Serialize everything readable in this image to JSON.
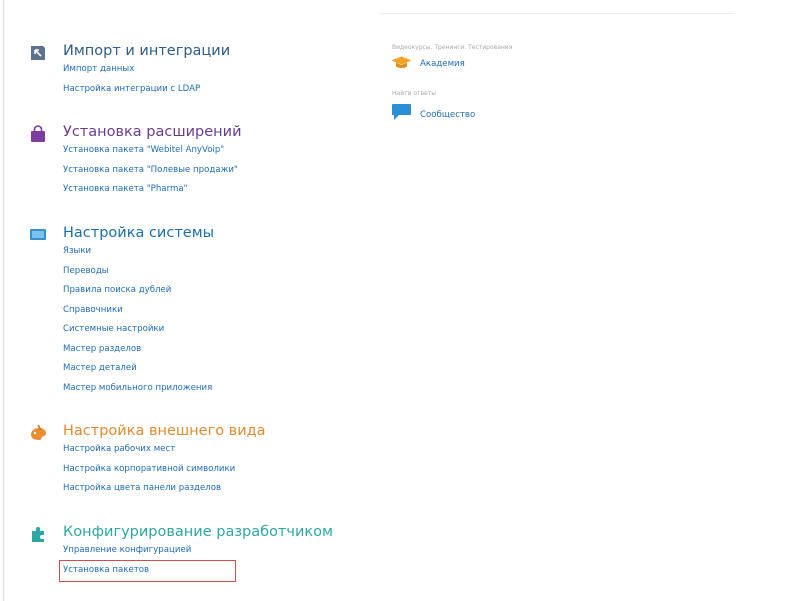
{
  "colors": {
    "link": "#1f6bb4",
    "import_title": "#2d5c86",
    "extensions_title": "#6a3c8e",
    "system_title": "#1d6fa7",
    "appearance_title": "#e08a32",
    "dev_title": "#2ea7a2",
    "highlight_border": "#d94a4a"
  },
  "sections": [
    {
      "icon": "import-icon",
      "title": "Импорт и интеграции",
      "links": [
        "Импорт данных",
        "Настройка интеграции с LDAP"
      ]
    },
    {
      "icon": "shopping-bag-icon",
      "title": "Установка расширений",
      "links": [
        "Установка пакета \"Webitel AnyVoip\"",
        "Установка пакета \"Полевые продажи\"",
        "Установка пакета \"Pharma\""
      ]
    },
    {
      "icon": "monitor-icon",
      "title": "Настройка системы",
      "links": [
        "Языки",
        "Переводы",
        "Правила поиска дублей",
        "Справочники",
        "Системные настройки",
        "Мастер разделов",
        "Мастер деталей",
        "Мастер мобильного приложения"
      ]
    },
    {
      "icon": "palette-icon",
      "title": "Настройка внешнего вида",
      "links": [
        "Настройка рабочих мест",
        "Настройка корпоративной символики",
        "Настройка цвета панели разделов"
      ]
    },
    {
      "icon": "puzzle-icon",
      "title": "Конфигурирование разработчиком",
      "links": [
        "Управление конфигурацией",
        "Установка пакетов"
      ]
    }
  ],
  "right_panel": {
    "academy_caption": "Видеокурсы. Тренинги. Тестирования",
    "academy_label": "Академия",
    "academy_icon": "graduation-cap-icon",
    "community_caption": "Найти ответы",
    "community_label": "Сообщество",
    "community_icon": "chat-bubble-icon"
  }
}
